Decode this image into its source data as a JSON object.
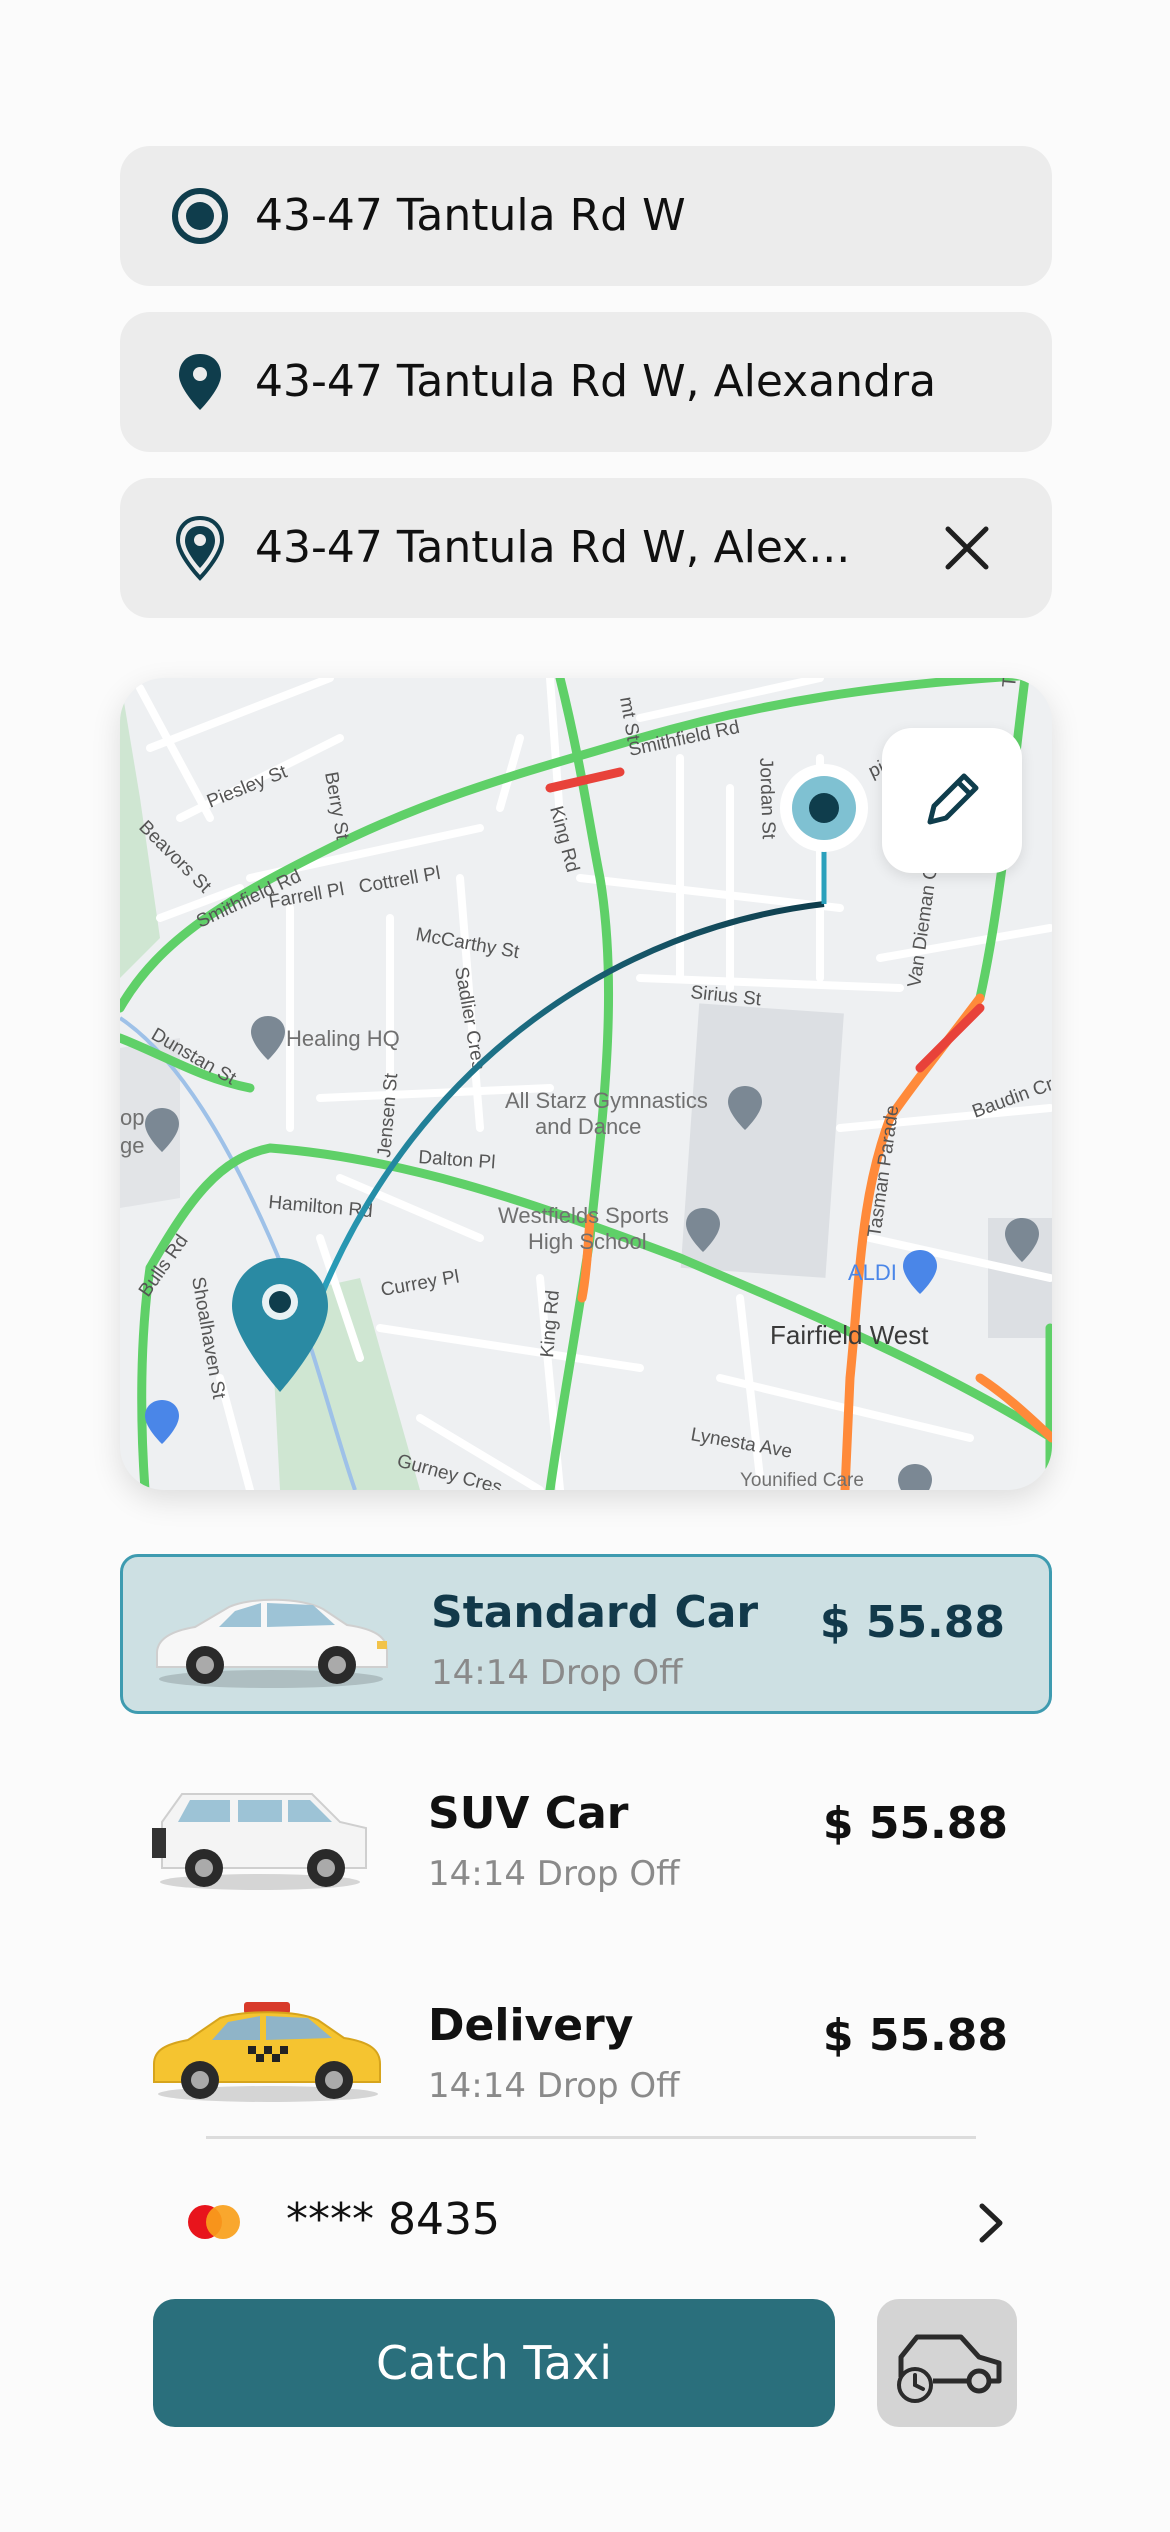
{
  "trip": {
    "origin": {
      "value": "43-47 Tantula Rd W",
      "icon": "origin-radio-icon"
    },
    "stop": {
      "value": "43-47 Tantula Rd W, Alexandra",
      "icon": "map-pin-icon"
    },
    "destination": {
      "value": "43-47 Tantula Rd W, Alex...",
      "icon": "map-pin-outline-icon",
      "clear_icon": "close-icon"
    }
  },
  "map": {
    "edit_icon": "pencil-icon",
    "street_labels": {
      "smithfield_top": "Smithfield Rd",
      "smithfield_left": "Smithfield Rd",
      "pielsey": "Piesley St",
      "berry": "Berry St",
      "beavors": "Beavors St",
      "farrell": "Farrell Pl",
      "cottrell": "Cottrell Pl",
      "mccarthy": "McCarthy St",
      "king_top": "King Rd",
      "king_bottom": "King Rd",
      "jordan": "Jordan St",
      "sirius": "Sirius St",
      "van_dieman": "Van Dieman Cres",
      "tasman": "Tasman Parade",
      "baudin": "Baudin Cre",
      "dunstan": "Dunstan St",
      "sadlier": "Sadlier Cres",
      "jensen": "Jensen St",
      "dalton": "Dalton Pl",
      "hamilton": "Hamilton Rd",
      "bulls": "Bulls Rd",
      "shoalhaven": "Shoalhaven St",
      "curry": "Currey Pl",
      "lynesta": "Lynesta Ave",
      "gurney": "Gurney Cres",
      "mt_st": "mt St",
      "parade_top": "Tasman Parade",
      "pier": "pier Cl"
    },
    "places": {
      "healing": "Healing HQ",
      "allstarz": "All Starz Gymnastics and Dance",
      "westfields": "Westfields Sports High School",
      "aldi": "ALDI",
      "fairfield": "Fairfield West",
      "op": "op",
      "ge": "ge",
      "unified": "Younified Care"
    }
  },
  "rides": [
    {
      "name": "Standard Car",
      "eta": "14:14 Drop Off",
      "price": "$ 55.88",
      "selected": true,
      "image": "white-sedan"
    },
    {
      "name": "SUV Car",
      "eta": "14:14 Drop Off",
      "price": "$ 55.88",
      "selected": false,
      "image": "white-suv"
    },
    {
      "name": "Delivery",
      "eta": "14:14 Drop Off",
      "price": "$ 55.88",
      "selected": false,
      "image": "yellow-taxi"
    }
  ],
  "payment": {
    "card_icon": "mastercard-icon",
    "masked_number": "**** 8435",
    "chevron_icon": "chevron-right-icon"
  },
  "actions": {
    "catch_label": "Catch Taxi",
    "schedule_icon": "scheduled-car-icon"
  },
  "colors": {
    "primary": "#2a6f7c",
    "dark_teal": "#0f3d4c",
    "selected_bg": "#cde0e3",
    "selected_border": "#3e9bb0",
    "field_bg": "#ececec"
  }
}
